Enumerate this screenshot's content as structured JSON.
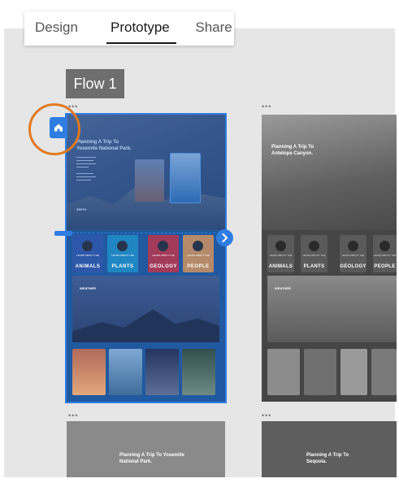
{
  "tabs": [
    {
      "label": "Design",
      "active": false
    },
    {
      "label": "Prototype",
      "active": true
    },
    {
      "label": "Share",
      "active": false
    }
  ],
  "flow_label": "Flow 1",
  "accent": "#2f7de1",
  "highlight_ring": "#e07a22",
  "artboards": {
    "a1": {
      "title": "Planning A Trip To Yosemite National Park.",
      "footer_tag": "SMITH",
      "tiles": [
        "ANIMALS",
        "PLANTS",
        "GEOLOGY",
        "PEOPLE"
      ],
      "tile_caption": "LEARN ABOUT THE",
      "weather_label": "WEATHER"
    },
    "a2": {
      "title": "Planning A Trip To Antelope Canyon.",
      "tiles": [
        "ANIMALS",
        "PLANTS",
        "GEOLOGY",
        "PEOPLE"
      ],
      "tile_caption": "LEARN ABOUT THE",
      "weather_label": "WEATHER"
    },
    "a3": {
      "title": "Planning A Trip To Yosemite National Park."
    },
    "a4": {
      "title": "Planning A Trip To Sequoia."
    }
  },
  "icons": {
    "home": "home-icon",
    "next": "chevron-right-icon"
  }
}
